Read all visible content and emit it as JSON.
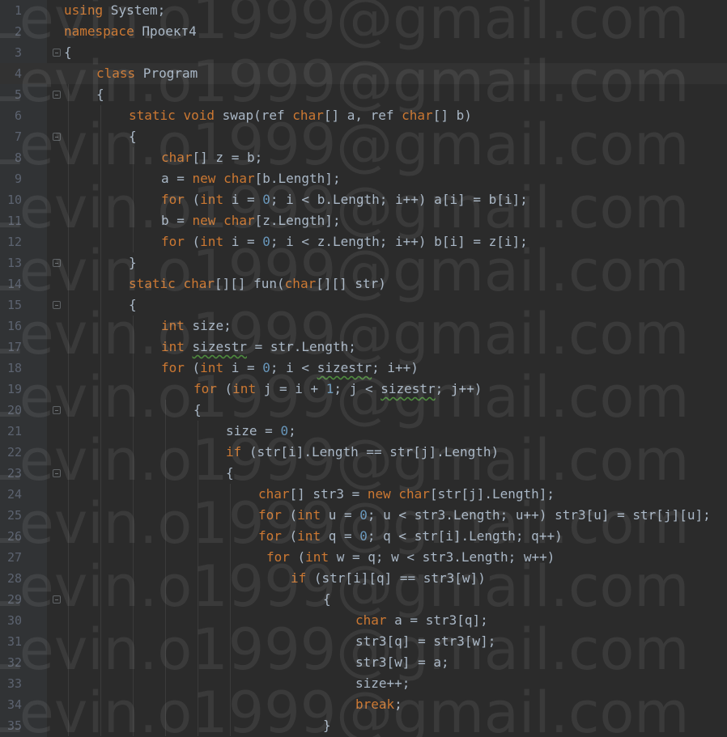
{
  "editor": {
    "watermark_text": "Levin.o1999@gmail.com",
    "colors": {
      "background": "#2b2b2b",
      "gutter": "#313335",
      "keyword": "#cc7832",
      "number": "#6897bb",
      "text": "#a9b7c6",
      "line_number": "#5c6370"
    },
    "lines": [
      {
        "n": "1",
        "indent": 0,
        "fold": false,
        "tokens": [
          {
            "t": "using",
            "k": "kw"
          },
          {
            "t": " System;"
          }
        ]
      },
      {
        "n": "2",
        "indent": 0,
        "fold": false,
        "tokens": [
          {
            "t": "namespace",
            "k": "kw"
          },
          {
            "t": " Проект4"
          }
        ]
      },
      {
        "n": "3",
        "indent": 0,
        "fold": true,
        "tokens": [
          {
            "t": "{"
          }
        ]
      },
      {
        "n": "4",
        "indent": 1,
        "fold": false,
        "tokens": [
          {
            "t": "class",
            "k": "kw"
          },
          {
            "t": " Program"
          }
        ]
      },
      {
        "n": "5",
        "indent": 1,
        "fold": true,
        "tokens": [
          {
            "t": "{"
          }
        ]
      },
      {
        "n": "6",
        "indent": 2,
        "fold": false,
        "tokens": [
          {
            "t": "static",
            "k": "kw"
          },
          {
            "t": " "
          },
          {
            "t": "void",
            "k": "kw"
          },
          {
            "t": " swap(ref "
          },
          {
            "t": "char",
            "k": "kw"
          },
          {
            "t": "[] a, ref "
          },
          {
            "t": "char",
            "k": "kw"
          },
          {
            "t": "[] b)"
          }
        ]
      },
      {
        "n": "7",
        "indent": 2,
        "fold": true,
        "tokens": [
          {
            "t": "{"
          }
        ]
      },
      {
        "n": "8",
        "indent": 3,
        "fold": false,
        "tokens": [
          {
            "t": "char",
            "k": "kw"
          },
          {
            "t": "[] z = b;"
          }
        ]
      },
      {
        "n": "9",
        "indent": 3,
        "fold": false,
        "tokens": [
          {
            "t": "a = "
          },
          {
            "t": "new",
            "k": "kw"
          },
          {
            "t": " "
          },
          {
            "t": "char",
            "k": "kw"
          },
          {
            "t": "[b.Length];"
          }
        ]
      },
      {
        "n": "10",
        "indent": 3,
        "fold": false,
        "tokens": [
          {
            "t": "for",
            "k": "kw"
          },
          {
            "t": " ("
          },
          {
            "t": "int",
            "k": "kw"
          },
          {
            "t": " i = "
          },
          {
            "t": "0",
            "k": "num"
          },
          {
            "t": "; i < b.Length; i++) a[i] = b[i];"
          }
        ]
      },
      {
        "n": "11",
        "indent": 3,
        "fold": false,
        "tokens": [
          {
            "t": "b = "
          },
          {
            "t": "new",
            "k": "kw"
          },
          {
            "t": " "
          },
          {
            "t": "char",
            "k": "kw"
          },
          {
            "t": "[z.Length];"
          }
        ]
      },
      {
        "n": "12",
        "indent": 3,
        "fold": false,
        "tokens": [
          {
            "t": "for",
            "k": "kw"
          },
          {
            "t": " ("
          },
          {
            "t": "int",
            "k": "kw"
          },
          {
            "t": " i = "
          },
          {
            "t": "0",
            "k": "num"
          },
          {
            "t": "; i < z.Length; i++) b[i] = z[i];"
          }
        ]
      },
      {
        "n": "13",
        "indent": 2,
        "fold": true,
        "tokens": [
          {
            "t": "}"
          }
        ]
      },
      {
        "n": "14",
        "indent": 2,
        "fold": false,
        "tokens": [
          {
            "t": "static",
            "k": "kw"
          },
          {
            "t": " "
          },
          {
            "t": "char",
            "k": "kw"
          },
          {
            "t": "[][] fun("
          },
          {
            "t": "char",
            "k": "kw"
          },
          {
            "t": "[][] str)"
          }
        ]
      },
      {
        "n": "15",
        "indent": 2,
        "fold": true,
        "tokens": [
          {
            "t": "{"
          }
        ]
      },
      {
        "n": "16",
        "indent": 3,
        "fold": false,
        "tokens": [
          {
            "t": "int",
            "k": "kw"
          },
          {
            "t": " size;"
          }
        ]
      },
      {
        "n": "17",
        "indent": 3,
        "fold": false,
        "tokens": [
          {
            "t": "int",
            "k": "kw"
          },
          {
            "t": " "
          },
          {
            "t": "sizestr",
            "k": "sq"
          },
          {
            "t": " = str.Length;"
          }
        ]
      },
      {
        "n": "18",
        "indent": 3,
        "fold": false,
        "tokens": [
          {
            "t": "for",
            "k": "kw"
          },
          {
            "t": " ("
          },
          {
            "t": "int",
            "k": "kw"
          },
          {
            "t": " i = "
          },
          {
            "t": "0",
            "k": "num"
          },
          {
            "t": "; i < "
          },
          {
            "t": "sizestr",
            "k": "sq"
          },
          {
            "t": "; i++)"
          }
        ]
      },
      {
        "n": "19",
        "indent": 4,
        "fold": false,
        "tokens": [
          {
            "t": "for",
            "k": "kw"
          },
          {
            "t": " ("
          },
          {
            "t": "int",
            "k": "kw"
          },
          {
            "t": " j = i + "
          },
          {
            "t": "1",
            "k": "num"
          },
          {
            "t": "; j < "
          },
          {
            "t": "sizestr",
            "k": "sq"
          },
          {
            "t": "; j++)"
          }
        ]
      },
      {
        "n": "20",
        "indent": 4,
        "fold": true,
        "tokens": [
          {
            "t": "{"
          }
        ]
      },
      {
        "n": "21",
        "indent": 5,
        "fold": false,
        "tokens": [
          {
            "t": "size = "
          },
          {
            "t": "0",
            "k": "num"
          },
          {
            "t": ";"
          }
        ]
      },
      {
        "n": "22",
        "indent": 5,
        "fold": false,
        "tokens": [
          {
            "t": "if",
            "k": "kw"
          },
          {
            "t": " (str[i].Length == str[j].Length)"
          }
        ]
      },
      {
        "n": "23",
        "indent": 5,
        "fold": true,
        "tokens": [
          {
            "t": "{"
          }
        ]
      },
      {
        "n": "24",
        "indent": 6,
        "fold": false,
        "tokens": [
          {
            "t": "char",
            "k": "kw"
          },
          {
            "t": "[] str3 = "
          },
          {
            "t": "new",
            "k": "kw"
          },
          {
            "t": " "
          },
          {
            "t": "char",
            "k": "kw"
          },
          {
            "t": "[str[j].Length];"
          }
        ]
      },
      {
        "n": "25",
        "indent": 6,
        "fold": false,
        "tokens": [
          {
            "t": "for",
            "k": "kw"
          },
          {
            "t": " ("
          },
          {
            "t": "int",
            "k": "kw"
          },
          {
            "t": " u = "
          },
          {
            "t": "0",
            "k": "num"
          },
          {
            "t": "; u < str3.Length; u++) str3[u] = str[j][u];"
          }
        ]
      },
      {
        "n": "26",
        "indent": 6,
        "fold": false,
        "tokens": [
          {
            "t": "for",
            "k": "kw"
          },
          {
            "t": " ("
          },
          {
            "t": "int",
            "k": "kw"
          },
          {
            "t": " q = "
          },
          {
            "t": "0",
            "k": "num"
          },
          {
            "t": "; q < str[i].Length; q++)"
          }
        ]
      },
      {
        "n": "27",
        "indent": 6,
        "pad": 1,
        "fold": false,
        "tokens": [
          {
            "t": "for",
            "k": "kw"
          },
          {
            "t": " ("
          },
          {
            "t": "int",
            "k": "kw"
          },
          {
            "t": " w = q; w < str3.Length; w++)"
          }
        ]
      },
      {
        "n": "28",
        "indent": 7,
        "fold": false,
        "tokens": [
          {
            "t": "if",
            "k": "kw"
          },
          {
            "t": " (str[i][q] == str3[w])"
          }
        ]
      },
      {
        "n": "29",
        "indent": 8,
        "fold": true,
        "tokens": [
          {
            "t": "{"
          }
        ]
      },
      {
        "n": "30",
        "indent": 9,
        "fold": false,
        "tokens": [
          {
            "t": "char",
            "k": "kw"
          },
          {
            "t": " a = str3[q];"
          }
        ]
      },
      {
        "n": "31",
        "indent": 9,
        "fold": false,
        "tokens": [
          {
            "t": "str3[q] = str3[w];"
          }
        ]
      },
      {
        "n": "32",
        "indent": 9,
        "fold": false,
        "tokens": [
          {
            "t": "str3[w] = a;"
          }
        ]
      },
      {
        "n": "33",
        "indent": 9,
        "fold": false,
        "tokens": [
          {
            "t": "size++;"
          }
        ]
      },
      {
        "n": "34",
        "indent": 9,
        "fold": false,
        "tokens": [
          {
            "t": "break",
            "k": "kw"
          },
          {
            "t": ";"
          }
        ]
      },
      {
        "n": "35",
        "indent": 8,
        "fold": false,
        "tokens": [
          {
            "t": "}"
          }
        ]
      }
    ]
  }
}
